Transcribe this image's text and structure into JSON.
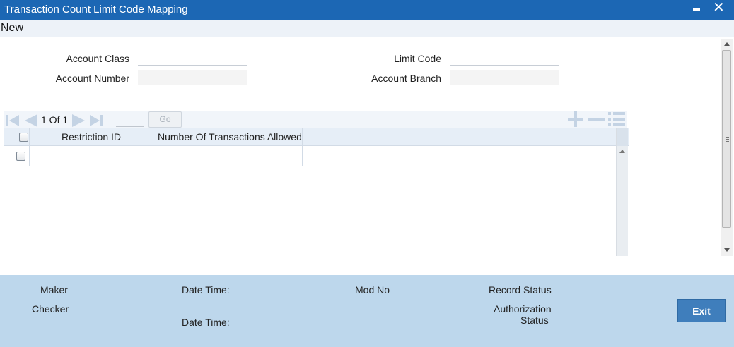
{
  "window": {
    "title": "Transaction Count Limit Code Mapping",
    "minimize_icon": "minimize-icon",
    "close_icon": "close-icon"
  },
  "menu": {
    "new_label": "New"
  },
  "form": {
    "account_class_label": "Account Class",
    "account_class_value": "",
    "account_number_label": "Account Number",
    "account_number_value": "",
    "limit_code_label": "Limit Code",
    "limit_code_value": "",
    "account_branch_label": "Account Branch",
    "account_branch_value": ""
  },
  "pager": {
    "text": "1 Of 1",
    "page_value": "",
    "go_label": "Go",
    "icons": [
      "first-page-icon",
      "prev-page-icon",
      "next-page-icon",
      "last-page-icon",
      "add-row-icon",
      "delete-row-icon",
      "view-row-icon"
    ]
  },
  "grid": {
    "columns": [
      "Restriction ID",
      "Number Of Transactions Allowed"
    ],
    "rows": [
      {
        "restriction_id": "",
        "number_allowed": ""
      }
    ]
  },
  "footer": {
    "maker_label": "Maker",
    "checker_label": "Checker",
    "date_time_label_1": "Date Time:",
    "date_time_label_2": "Date Time:",
    "mod_no_label": "Mod No",
    "record_status_label": "Record Status",
    "authorization_status_line1": "Authorization",
    "authorization_status_line2": "Status",
    "exit_label": "Exit"
  },
  "colors": {
    "titlebar": "#1c67b4",
    "footer": "#bdd7ec",
    "exit_button": "#3f7ebc"
  }
}
